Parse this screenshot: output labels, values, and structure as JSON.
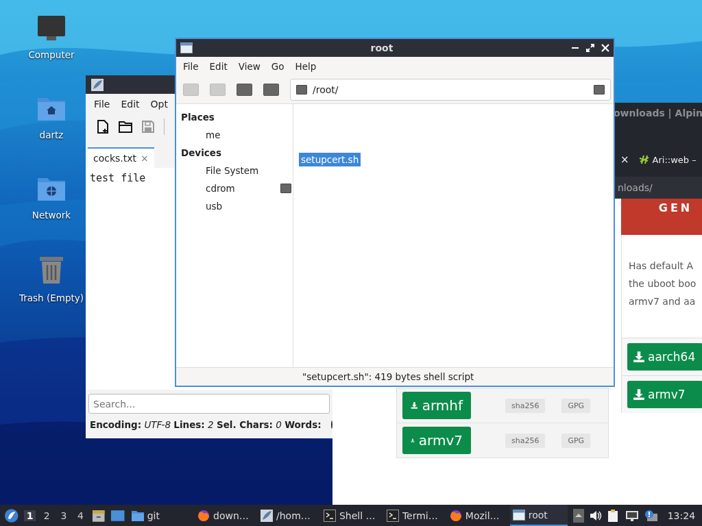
{
  "desktop_icons": [
    {
      "kind": "computer",
      "label": "Computer"
    },
    {
      "kind": "home",
      "label": "dartz"
    },
    {
      "kind": "network",
      "label": "Network"
    },
    {
      "kind": "trash",
      "label": "Trash (Empty)"
    }
  ],
  "browser": {
    "title": "ownloads | Alpin",
    "tab_close": "×",
    "tab": "Ari::web –",
    "address": "nloads/",
    "banner": "GEN",
    "card_lines": [
      "Has default A",
      "the uboot boo",
      "armv7 and aa"
    ],
    "card_buttons": [
      "aarch64",
      "armv7"
    ],
    "downloads": [
      {
        "file": "armhf",
        "checksum": "sha256",
        "signature": "GPG"
      },
      {
        "file": "armv7",
        "checksum": "sha256",
        "signature": "GPG"
      }
    ]
  },
  "editor": {
    "menu": [
      "File",
      "Edit",
      "Opt"
    ],
    "toolbar": [
      {
        "kind": "new",
        "disabled": false
      },
      {
        "kind": "open",
        "disabled": false
      },
      {
        "kind": "save",
        "disabled": true
      }
    ],
    "tab": {
      "label": "cocks.txt",
      "close": "×"
    },
    "text": "test file",
    "search": {
      "placeholder": "Search..."
    },
    "status": "**Encoding:** *UTF-8*  **Lines:** *2*  **Sel. Chars:** *0*  **Words:**"
  },
  "file_manager": {
    "title": "root",
    "menu": [
      "File",
      "Edit",
      "View",
      "Go",
      "Help"
    ],
    "toolbar": [
      {
        "disabled": true
      },
      {
        "disabled": true
      },
      {
        "disabled": false
      },
      {
        "disabled": false
      }
    ],
    "location": "/root/",
    "sidebar": [
      {
        "heading": "Places",
        "items": [
          {
            "label": "me",
            "kind": "plain"
          }
        ]
      },
      {
        "heading": "Devices",
        "items": [
          {
            "label": "File System",
            "kind": "plain"
          },
          {
            "label": "cdrom",
            "kind": "ejectable"
          },
          {
            "label": "usb",
            "kind": "plain"
          }
        ]
      }
    ],
    "files": [
      {
        "name": "setupcert.sh",
        "selected": true
      }
    ],
    "status": "\"setupcert.sh\": 419 bytes shell script"
  },
  "taskbar": {
    "workspaces": [
      {
        "label": "1",
        "selected": true
      },
      {
        "label": "2",
        "selected": false
      },
      {
        "label": "3",
        "selected": false
      },
      {
        "label": "4",
        "selected": false
      }
    ],
    "launchers": [
      {
        "kind": "files"
      },
      {
        "kind": "desktop"
      },
      {
        "kind": "folder",
        "label": "git"
      }
    ],
    "tasks": [
      {
        "kind": "browser",
        "label": "down…",
        "selected": false
      },
      {
        "kind": "editor",
        "label": "/hom…",
        "selected": false
      },
      {
        "kind": "terminal",
        "label": "Shell …",
        "selected": false
      },
      {
        "kind": "terminal",
        "label": "Termi…",
        "selected": false
      },
      {
        "kind": "browser",
        "label": "Mozil…",
        "selected": false
      },
      {
        "kind": "window",
        "label": "root",
        "selected": true
      }
    ],
    "clock": "13:24"
  }
}
